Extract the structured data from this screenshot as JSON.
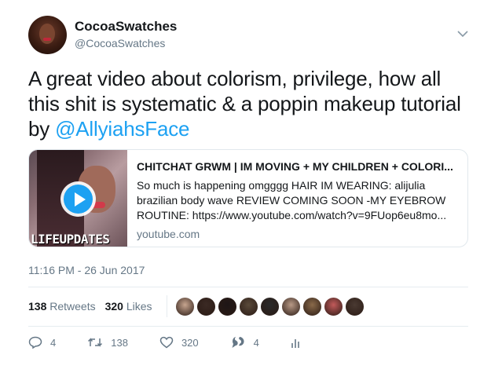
{
  "user": {
    "display_name": "CocoaSwatches",
    "handle": "@CocoaSwatches"
  },
  "tweet": {
    "text_before": "A great video about colorism, privilege, how all this shit is systematic & a poppin makeup tutorial by ",
    "mention": "@AllyiahsFace"
  },
  "card": {
    "title": "CHITCHAT GRWM | IM MOVING + MY CHILDREN + COLORI...",
    "description": "So much is happening omgggg HAIR IM WEARING: alijulia brazilian body wave REVIEW COMING SOON -MY EYEBROW ROUTINE: https://www.youtube.com/watch?v=9FUop6eu8mo...",
    "domain": "youtube.com",
    "thumb_caption": "LIFEUPDATES"
  },
  "timestamp": "11:16 PM - 26 Jun 2017",
  "stats": {
    "retweets_count": "138",
    "retweets_label": "Retweets",
    "likes_count": "320",
    "likes_label": "Likes"
  },
  "likers": [
    "#c7a58f",
    "#3b2a24",
    "#1e1616",
    "#5a4a3a",
    "#2a2a2a",
    "#b89a86",
    "#8a6a4a",
    "#c25a5a",
    "#4a3a32"
  ],
  "actions": {
    "reply_count": "4",
    "retweet_count": "138",
    "like_count": "320",
    "moments_count": "4"
  },
  "colors": {
    "accent": "#1da1f2",
    "secondary": "#657786"
  }
}
